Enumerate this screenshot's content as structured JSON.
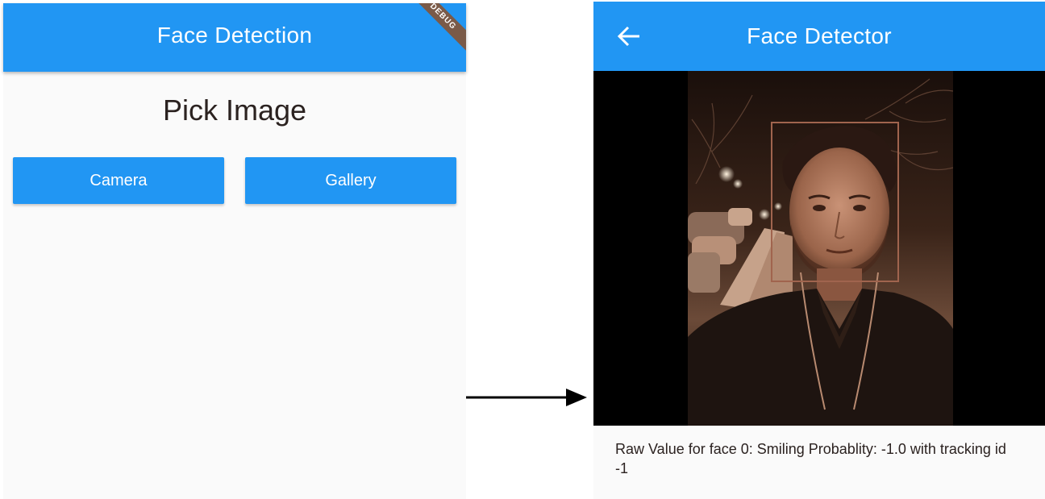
{
  "left_screen": {
    "appbar_title": "Face Detection",
    "debug_banner": "DEBUG",
    "heading": "Pick Image",
    "buttons": {
      "camera": "Camera",
      "gallery": "Gallery"
    }
  },
  "right_screen": {
    "appbar_title": "Face Detector",
    "back_icon": "arrow-back-icon",
    "result_text": "Raw Value for face 0: Smiling Probablity: -1.0 with tracking id -1"
  },
  "colors": {
    "primary": "#2196f3",
    "background": "#fafafa",
    "text": "#2b2220",
    "face_box": "#a0644e"
  }
}
